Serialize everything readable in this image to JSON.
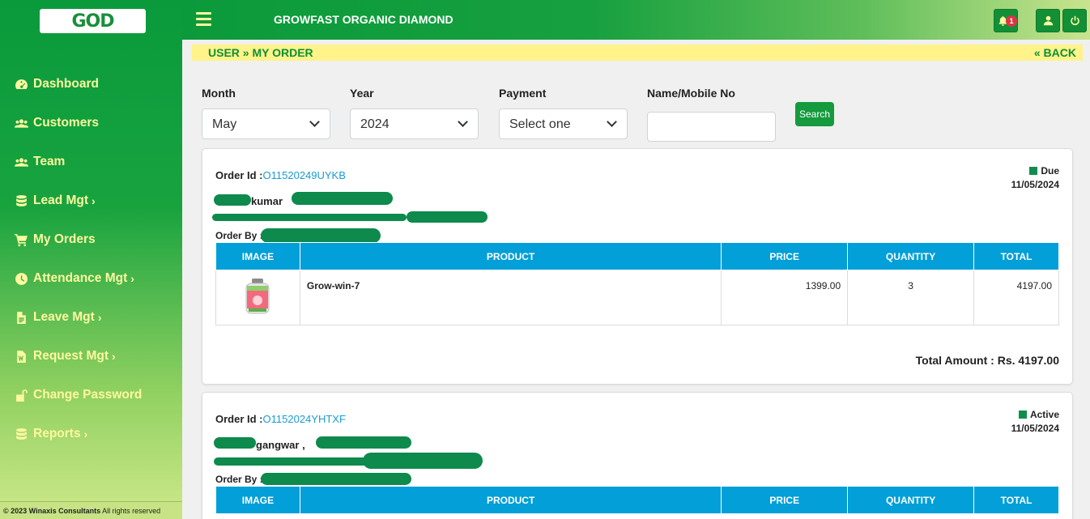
{
  "sidebar": {
    "logo_text": "GOD",
    "items": [
      {
        "label": "Dashboard",
        "icon": "dashboard-icon",
        "chevron": false
      },
      {
        "label": "Customers",
        "icon": "users-icon",
        "chevron": false
      },
      {
        "label": "Team",
        "icon": "users-icon",
        "chevron": false
      },
      {
        "label": "Lead Mgt",
        "icon": "database-icon",
        "chevron": true
      },
      {
        "label": "My Orders",
        "icon": "cart-icon",
        "chevron": false
      },
      {
        "label": "Attendance Mgt",
        "icon": "clock-icon",
        "chevron": true
      },
      {
        "label": "Leave Mgt",
        "icon": "document-icon",
        "chevron": true
      },
      {
        "label": "Request Mgt",
        "icon": "word-file-icon",
        "chevron": true
      },
      {
        "label": "Change Password",
        "icon": "unlock-icon",
        "chevron": false
      },
      {
        "label": "Reports",
        "icon": "database-icon",
        "chevron": true
      }
    ],
    "footer_company": "© 2023 Winaxis Consultants",
    "footer_rights": " All rights reserved"
  },
  "topbar": {
    "brand": "GROWFAST ORGANIC DIAMOND",
    "notification_count": "1"
  },
  "breadcrumb": {
    "path": "USER » MY ORDER",
    "back": "« BACK"
  },
  "filters": {
    "month_label": "Month",
    "month_value": "May",
    "year_label": "Year",
    "year_value": "2024",
    "payment_label": "Payment",
    "payment_value": "Select one",
    "name_label": "Name/Mobile No",
    "name_value": "",
    "search_label": "Search"
  },
  "table_headers": [
    "IMAGE",
    "PRODUCT",
    "PRICE",
    "QUANTITY",
    "TOTAL"
  ],
  "orders": [
    {
      "order_id_label": "Order Id :",
      "order_id": "O11520249UYKB",
      "status": "Due",
      "date": "11/05/2024",
      "customer": "kumar",
      "order_by_label": "Order By :",
      "items": [
        {
          "product": "Grow-win-7",
          "price": "1399.00",
          "quantity": "3",
          "total": "4197.00"
        }
      ],
      "total_amount": "Total Amount : Rs. 4197.00"
    },
    {
      "order_id_label": "Order Id :",
      "order_id": "O1152024YHTXF",
      "status": "Active",
      "date": "11/05/2024",
      "customer": "gangwar ,",
      "order_by_label": "Order By :"
    }
  ],
  "colors": {
    "brand_green": "#0b9a3b",
    "highlight_yellow": "#fff38a",
    "table_header_blue": "#029fd8",
    "status_green": "#128c4e",
    "redaction": "#0d8a4c"
  }
}
